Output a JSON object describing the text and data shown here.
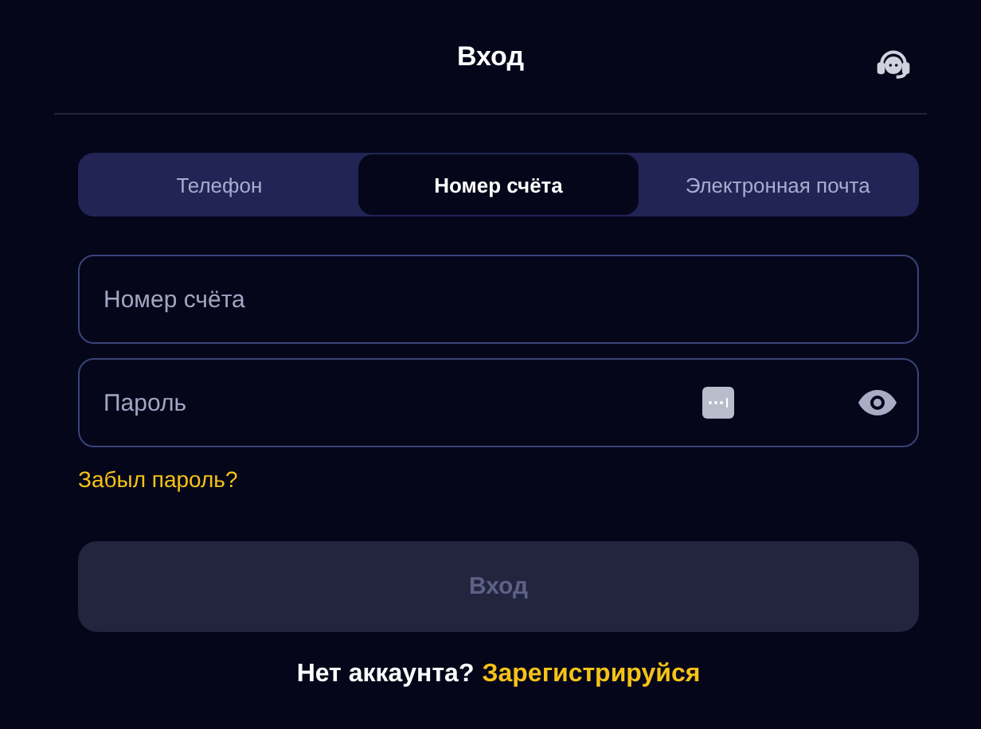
{
  "header": {
    "title": "Вход"
  },
  "tabs": [
    {
      "label": "Телефон",
      "selected": false
    },
    {
      "label": "Номер счёта",
      "selected": true
    },
    {
      "label": "Электронная почта",
      "selected": false
    }
  ],
  "fields": [
    {
      "placeholder": "Номер счёта",
      "kind": "text"
    },
    {
      "placeholder": "Пароль",
      "kind": "password"
    }
  ],
  "forgot_link": "Забыл пароль?",
  "submit": {
    "label": "Вход",
    "disabled": true
  },
  "footer": {
    "text": "Нет аккаунта?",
    "link": "Зарегистрируйся"
  }
}
